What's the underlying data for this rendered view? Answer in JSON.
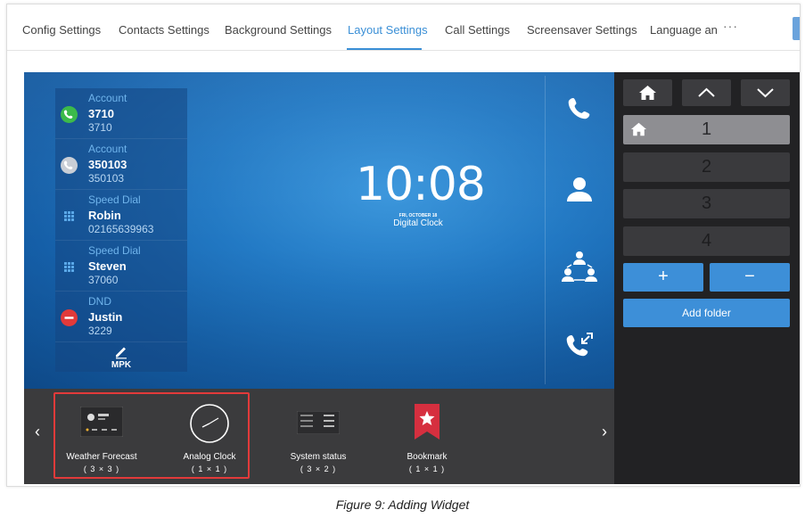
{
  "tabs": [
    {
      "label": "Config Settings"
    },
    {
      "label": "Contacts Settings"
    },
    {
      "label": "Background Settings"
    },
    {
      "label": "Layout Settings",
      "active": true
    },
    {
      "label": "Call Settings"
    },
    {
      "label": "Screensaver Settings"
    },
    {
      "label": "Language an"
    }
  ],
  "tabs_more": "···",
  "mpk": {
    "rows": [
      {
        "type": "Account",
        "name": "3710",
        "number": "3710",
        "icon": "phone-green-icon"
      },
      {
        "type": "Account",
        "name": "350103",
        "number": "350103",
        "icon": "phone-grey-icon"
      },
      {
        "type": "Speed Dial",
        "name": "Robin",
        "number": "02165639963",
        "icon": "dialpad-icon"
      },
      {
        "type": "Speed Dial",
        "name": "Steven",
        "number": "37060",
        "icon": "dialpad-icon"
      },
      {
        "type": "DND",
        "name": "Justin",
        "number": "3229",
        "icon": "dnd-icon"
      }
    ],
    "footer_label": "MPK"
  },
  "clock": {
    "time": "10:08",
    "date": "FRI, OCTOBER 18",
    "label": "Digital Clock"
  },
  "side_icons": [
    "phone-icon",
    "contact-icon",
    "conference-icon",
    "call-history-icon"
  ],
  "widgets": [
    {
      "name": "Weather Forecast",
      "size": "( 3 × 3 )",
      "icon": "weather-widget-icon"
    },
    {
      "name": "Analog Clock",
      "size": "( 1 × 1 )",
      "icon": "analog-clock-icon"
    },
    {
      "name": "System status",
      "size": "( 3 × 2 )",
      "icon": "system-status-icon"
    },
    {
      "name": "Bookmark",
      "size": "( 1 × 1 )",
      "icon": "bookmark-icon"
    }
  ],
  "folders": {
    "items": [
      "1",
      "2",
      "3",
      "4"
    ],
    "active_index": 0,
    "add_label": "+",
    "remove_label": "−",
    "add_folder_label": "Add folder"
  },
  "colors": {
    "accent": "#3a8fd6",
    "selection": "#e23a3a",
    "button": "#3d8fd8"
  },
  "caption": "Figure 9: Adding Widget"
}
